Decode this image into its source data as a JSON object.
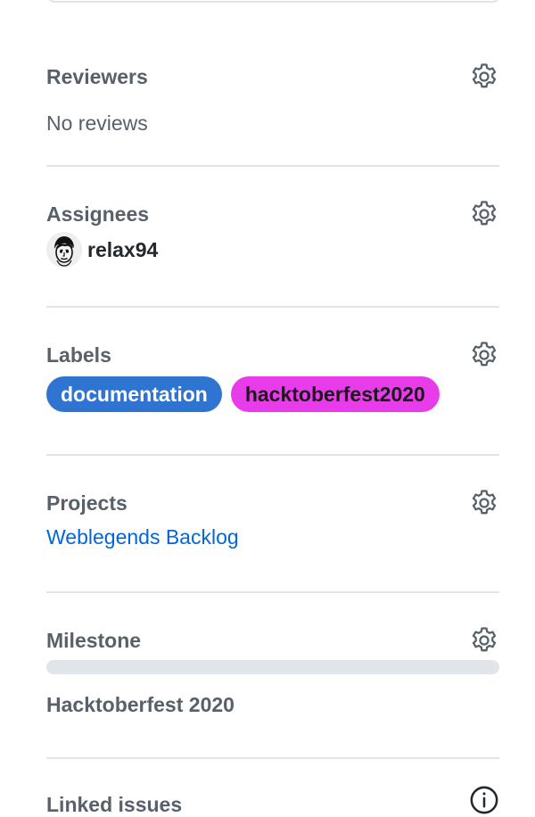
{
  "sidebar": {
    "reviewers": {
      "heading": "Reviewers",
      "empty_text": "No reviews"
    },
    "assignees": {
      "heading": "Assignees",
      "users": [
        {
          "login": "relax94"
        }
      ]
    },
    "labels": {
      "heading": "Labels",
      "items": [
        {
          "name": "documentation",
          "color": "#2f74d0",
          "text_color": "#ffffff"
        },
        {
          "name": "hacktoberfest2020",
          "color": "#e83ceb",
          "text_color": "#1a1a1a"
        }
      ]
    },
    "projects": {
      "heading": "Projects",
      "items": [
        {
          "name": "Weblegends Backlog"
        }
      ]
    },
    "milestone": {
      "heading": "Milestone",
      "title": "Hacktoberfest 2020",
      "progress_percent": 0
    },
    "linked_issues": {
      "heading": "Linked issues"
    }
  },
  "colors": {
    "heading": "#586069",
    "link": "#0366d6",
    "divider": "#e1e4e8",
    "progress_track": "#e1e4e8"
  },
  "icons": {
    "settings": "gear-icon",
    "info": "info-icon"
  }
}
